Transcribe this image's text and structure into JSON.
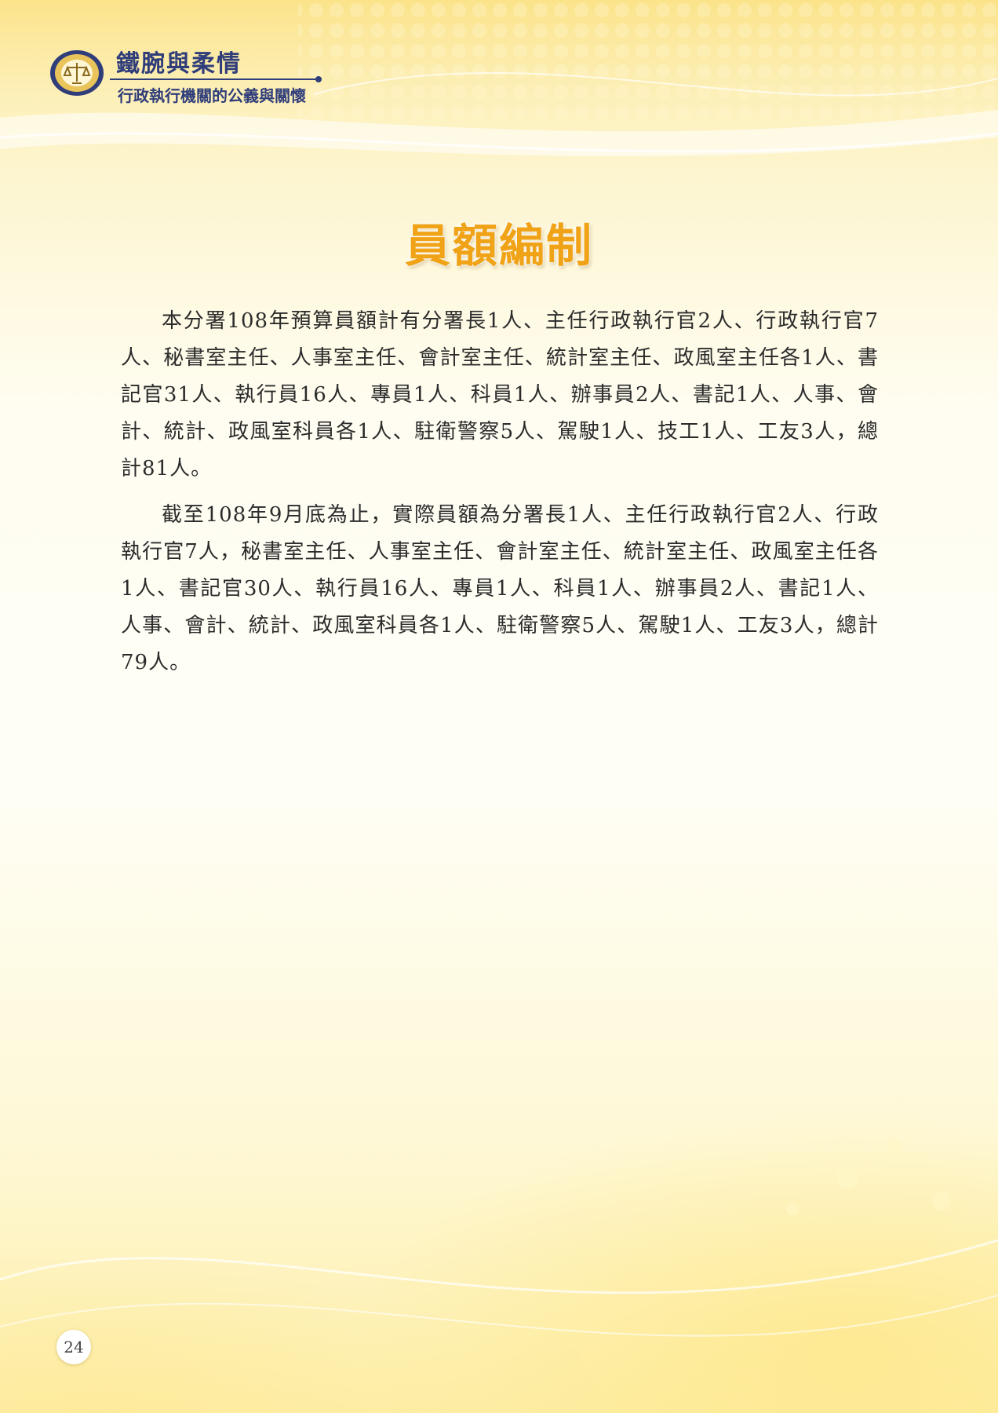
{
  "header": {
    "title": "鐵腕與柔情",
    "subtitle": "行政執行機關的公義與關懷"
  },
  "section_title": "員額編制",
  "paragraphs": [
    "本分署108年預算員額計有分署長1人、主任行政執行官2人、行政執行官7人、秘書室主任、人事室主任、會計室主任、統計室主任、政風室主任各1人、書記官31人、執行員16人、專員1人、科員1人、辦事員2人、書記1人、人事、會計、統計、政風室科員各1人、駐衛警察5人、駕駛1人、技工1人、工友3人，總計81人。",
    "截至108年9月底為止，實際員額為分署長1人、主任行政執行官2人、行政執行官7人，秘書室主任、人事室主任、會計室主任、統計室主任、政風室主任各1人、書記官30人、執行員16人、專員1人、科員1人、辦事員2人、書記1人、人事、會計、統計、政風室科員各1人、駐衛警察5人、駕駛1人、工友3人，總計79人。"
  ],
  "page_number": "24",
  "colors": {
    "title_orange": "#f0a316",
    "header_navy": "#2f3d7a",
    "logo_gold": "#c99a2e"
  }
}
